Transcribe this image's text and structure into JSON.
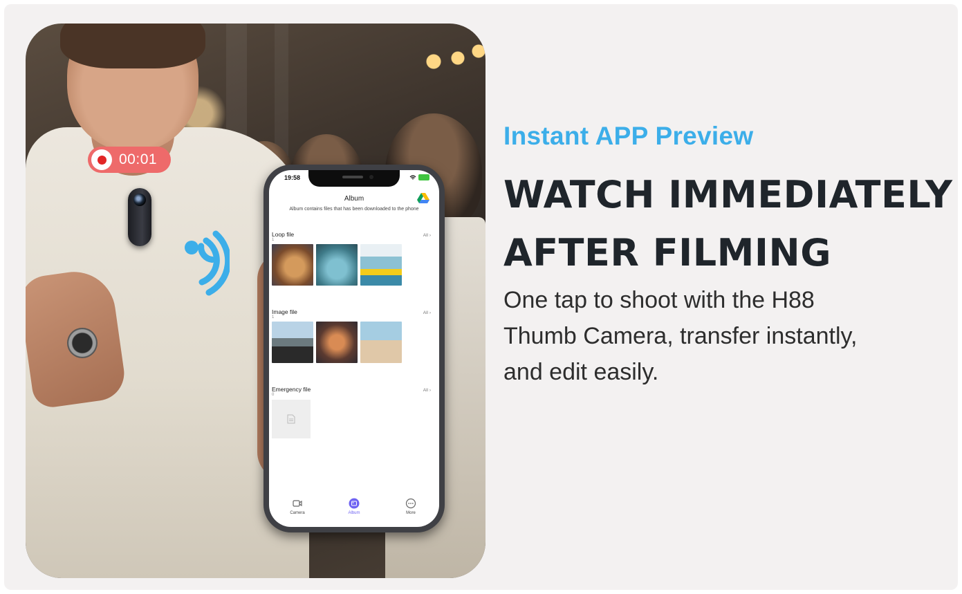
{
  "recording": {
    "time": "00:01"
  },
  "phone": {
    "status_time": "19:58",
    "app_title": "Album",
    "app_subtitle": "Album contains files that has been downloaded to the phone",
    "sections": [
      {
        "title": "Loop file",
        "count": "1",
        "all_label": "All"
      },
      {
        "title": "Image file",
        "count": "1",
        "all_label": "All"
      },
      {
        "title": "Emergency file",
        "count": "0",
        "all_label": "All"
      }
    ],
    "tabs": [
      {
        "label": "Camera"
      },
      {
        "label": "Album"
      },
      {
        "label": "More"
      }
    ]
  },
  "eyebrow": "Instant APP Preview",
  "headline_lines": [
    "WATCH IMMEDIATELY",
    "AFTER FILMING"
  ],
  "body_lines": [
    "One tap to shoot with the H88",
    "Thumb Camera, transfer instantly,",
    "and edit easily."
  ],
  "colors": {
    "accent_blue": "#3caee9",
    "headline": "#1f252b",
    "record_badge": "#ee6a6a",
    "tab_active": "#6f63f2"
  }
}
